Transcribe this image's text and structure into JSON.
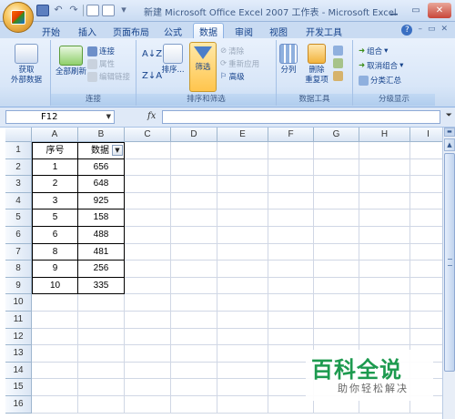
{
  "window": {
    "title": "新建 Microsoft Office Excel 2007 工作表 - Microsoft Excel"
  },
  "tabs": [
    {
      "label": "开始"
    },
    {
      "label": "插入"
    },
    {
      "label": "页面布局"
    },
    {
      "label": "公式"
    },
    {
      "label": "数据",
      "active": true
    },
    {
      "label": "审阅"
    },
    {
      "label": "视图"
    },
    {
      "label": "开发工具"
    }
  ],
  "ribbon": {
    "get_external": {
      "label": "获取\n外部数据"
    },
    "connections": {
      "refresh_all": "全部刷新",
      "connections": "连接",
      "properties": "属性",
      "edit_links": "编辑链接",
      "group_label": "连接"
    },
    "sort_filter": {
      "sort": "排序...",
      "filter": "筛选",
      "clear": "清除",
      "reapply": "重新应用",
      "advanced": "高级",
      "group_label": "排序和筛选"
    },
    "data_tools": {
      "text_to_columns": "分列",
      "remove_duplicates": "删除\n重复项",
      "group_label": "数据工具"
    },
    "outline": {
      "group": "组合",
      "ungroup": "取消组合",
      "subtotal": "分类汇总",
      "group_label": "分级显示"
    }
  },
  "formula_bar": {
    "name_box": "F12",
    "fx": "fx",
    "formula": ""
  },
  "sheet": {
    "columns": [
      "A",
      "B",
      "C",
      "D",
      "E",
      "F",
      "G",
      "H",
      "I"
    ],
    "row_numbers": [
      "1",
      "2",
      "3",
      "4",
      "5",
      "6",
      "7",
      "8",
      "9",
      "10",
      "11",
      "12",
      "13",
      "14",
      "15",
      "16"
    ],
    "header": [
      "序号",
      "数据"
    ],
    "rows": [
      [
        "1",
        "656"
      ],
      [
        "2",
        "648"
      ],
      [
        "3",
        "925"
      ],
      [
        "5",
        "158"
      ],
      [
        "6",
        "488"
      ],
      [
        "8",
        "481"
      ],
      [
        "9",
        "256"
      ],
      [
        "10",
        "335"
      ]
    ]
  },
  "watermark": {
    "title": "百科全说",
    "subtitle": "助你轻松解决"
  }
}
